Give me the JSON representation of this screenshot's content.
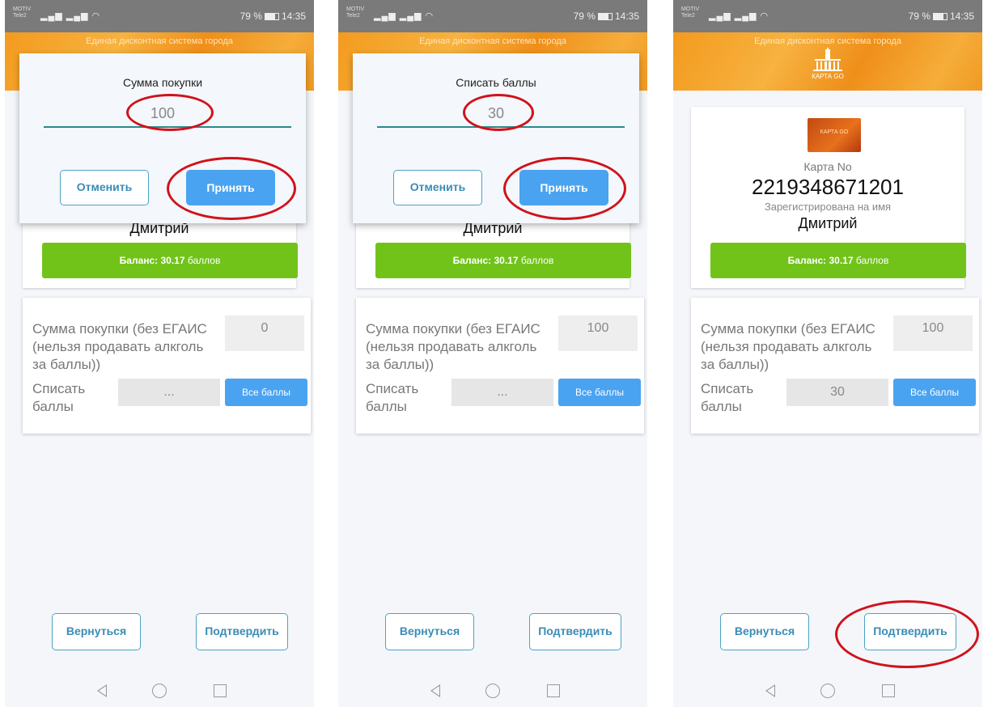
{
  "status": {
    "operator1": "MOTIV",
    "operator2": "Tele2",
    "battery_text": "79 %",
    "time": "14:35"
  },
  "header": {
    "title": "Единая дисконтная система города",
    "logo_text": "КАРТА GO"
  },
  "card": {
    "label": "Карта No",
    "number": "2219348671201",
    "registered_label": "Зарегистрирована на имя",
    "name": "Дмитрий",
    "balance_prefix": "Баланс: 30.17",
    "balance_unit": "баллов"
  },
  "form": {
    "purchase_label": "Сумма покупки (без ЕГАИС (нельзя продавать алкголь за баллы))",
    "writeoff_label": "Списать баллы",
    "all_points_button": "Все баллы",
    "empty_placeholder": "..."
  },
  "footer": {
    "back_button": "Вернуться",
    "confirm_button": "Подтвердить"
  },
  "screens": [
    {
      "name_peek": "Дмитрий",
      "purchase_value": "0",
      "writeoff_value": "...",
      "dialog": {
        "title": "Сумма покупки",
        "value": "100",
        "cancel": "Отменить",
        "accept": "Принять"
      }
    },
    {
      "name_peek": "Дмитрий",
      "purchase_value": "100",
      "writeoff_value": "...",
      "dialog": {
        "title": "Списать баллы",
        "value": "30",
        "cancel": "Отменить",
        "accept": "Принять"
      }
    },
    {
      "purchase_value": "100",
      "writeoff_value": "30"
    }
  ],
  "annotation_color": "#d0121b",
  "accent_colors": {
    "balance": "#71c31a",
    "primary_button": "#4aa3f0",
    "header": "#f39a1e"
  }
}
